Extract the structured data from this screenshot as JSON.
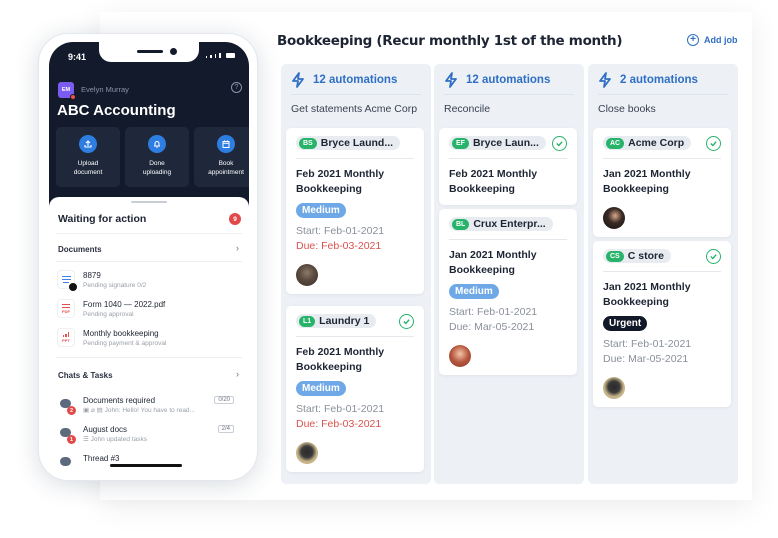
{
  "board": {
    "title": "Bookkeeping (Recur monthly 1st of the month)",
    "add_job_label": "Add job",
    "columns": [
      {
        "automations": "12 automations",
        "name": "Get statements Acme Corp",
        "cards": [
          {
            "chip_initials": "BS",
            "chip_label": "Bryce Laund...",
            "checked": false,
            "title": "Feb 2021 Monthly Bookkeeping",
            "priority": "Medium",
            "start": "Start: Feb-01-2021",
            "due": "Due: Feb-03-2021",
            "overdue": true,
            "avatar": "avatar"
          },
          {
            "chip_initials": "L1",
            "chip_label": "Laundry 1",
            "checked": true,
            "title": "Feb 2021 Monthly Bookkeeping",
            "priority": "Medium",
            "start": "Start: Feb-01-2021",
            "due": "Due: Feb-03-2021",
            "overdue": true,
            "avatar": "avatar"
          }
        ]
      },
      {
        "automations": "12 automations",
        "name": "Reconcile",
        "cards": [
          {
            "chip_initials": "EF",
            "chip_label": "Bryce Laun...",
            "checked": true,
            "title": "Feb 2021 Monthly Bookkeeping"
          },
          {
            "chip_initials": "BL",
            "chip_label": "Crux Enterpr...",
            "checked": false,
            "title": "Jan 2021 Monthly Bookkeeping",
            "priority": "Medium",
            "start": "Start: Feb-01-2021",
            "due": "Due: Mar-05-2021",
            "overdue": false,
            "avatar": "avatar"
          }
        ]
      },
      {
        "automations": "2 automations",
        "name": "Close books",
        "cards": [
          {
            "chip_initials": "AC",
            "chip_label": "Acme Corp",
            "checked": true,
            "title": "Jan 2021 Monthly Bookkeeping",
            "avatar": "avatar"
          },
          {
            "chip_initials": "CS",
            "chip_label": "C store",
            "checked": true,
            "title": "Jan 2021 Monthly Bookkeeping",
            "priority": "Urgent",
            "start": "Start: Feb-01-2021",
            "due": "Due: Mar-05-2021",
            "overdue": false,
            "avatar": "avatar"
          }
        ]
      }
    ]
  },
  "phone": {
    "time": "9:41",
    "user_initials": "EM",
    "user_name": "Evelyn Murray",
    "help_icon": "?",
    "org_name": "ABC Accounting",
    "actions": [
      {
        "icon": "upload-icon",
        "label_line1": "Upload",
        "label_line2": "document"
      },
      {
        "icon": "bell-icon",
        "label_line1": "Done",
        "label_line2": "uploading"
      },
      {
        "icon": "calendar-icon",
        "label_line1": "Book",
        "label_line2": "appointment"
      }
    ],
    "waiting_title": "Waiting for action",
    "waiting_count": "9",
    "documents_title": "Documents",
    "documents": [
      {
        "name": "8879",
        "sub": "Pending signature 0/2",
        "icon": "doc-lock-icon"
      },
      {
        "name": "Form 1040 — 2022.pdf",
        "sub": "Pending approval",
        "icon": "pdf-icon"
      },
      {
        "name": "Monthly bookkeeping",
        "sub": "Pending payment & approval",
        "icon": "ppt-icon"
      }
    ],
    "chats_title": "Chats & Tasks",
    "chats": [
      {
        "name": "Documents required",
        "sub": "John: Hello! You have to read...",
        "badge": "2",
        "count": "0/20"
      },
      {
        "name": "August docs",
        "sub": "John updated tasks",
        "badge": "1",
        "count": "2/4"
      },
      {
        "name": "Thread #3",
        "sub": "",
        "badge": "",
        "count": ""
      }
    ],
    "chevron": "›"
  },
  "colors": {
    "accent": "#2f6fc4",
    "success": "#27b36a",
    "danger": "#d9534f",
    "dark": "#121a2c"
  }
}
